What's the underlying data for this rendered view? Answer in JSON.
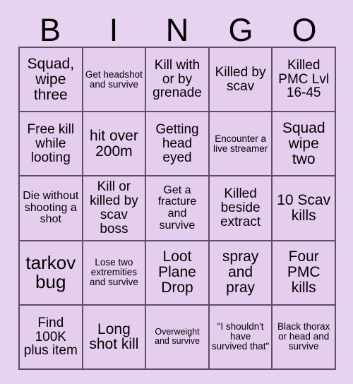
{
  "card": {
    "title": "BINGO",
    "background_color": "#e7d2ef",
    "cell_color": "#e5cdee",
    "border_color": "#5b4f63",
    "text_color": "#000000"
  },
  "header": {
    "letters": [
      "B",
      "I",
      "N",
      "G",
      "O"
    ]
  },
  "grid": {
    "rows": 5,
    "columns": 5,
    "cells": [
      {
        "text": "Squad, wipe three",
        "size": "lg"
      },
      {
        "text": "Get headshot and survive",
        "size": "xs"
      },
      {
        "text": "Kill with or by grenade",
        "size": "md"
      },
      {
        "text": "Killed by scav",
        "size": "md"
      },
      {
        "text": "Killed PMC Lvl 16-45",
        "size": "md"
      },
      {
        "text": "Free kill while looting",
        "size": "md"
      },
      {
        "text": "hit over 200m",
        "size": "lg"
      },
      {
        "text": "Getting head eyed",
        "size": "md"
      },
      {
        "text": "Encounter a live streamer",
        "size": "xs"
      },
      {
        "text": "Squad wipe two",
        "size": "lg"
      },
      {
        "text": "Die without shooting a shot",
        "size": "sm"
      },
      {
        "text": "Kill or killed by scav boss",
        "size": "md"
      },
      {
        "text": "Get a fracture and survive",
        "size": "sm"
      },
      {
        "text": "Killed beside extract",
        "size": "md"
      },
      {
        "text": "10 Scav kills",
        "size": "lg"
      },
      {
        "text": "tarkov bug",
        "size": "xl"
      },
      {
        "text": "Lose two extremities and survive",
        "size": "xs"
      },
      {
        "text": "Loot Plane Drop",
        "size": "lg"
      },
      {
        "text": "spray and pray",
        "size": "lg"
      },
      {
        "text": "Four PMC kills",
        "size": "lg"
      },
      {
        "text": "Find 100K plus item",
        "size": "md"
      },
      {
        "text": "Long shot kill",
        "size": "lg"
      },
      {
        "text": "Overweight and survive",
        "size": "xxs"
      },
      {
        "text": "\"I shouldn't have survived that\"",
        "size": "xs"
      },
      {
        "text": "Black thorax or head and survive",
        "size": "xs"
      }
    ]
  }
}
